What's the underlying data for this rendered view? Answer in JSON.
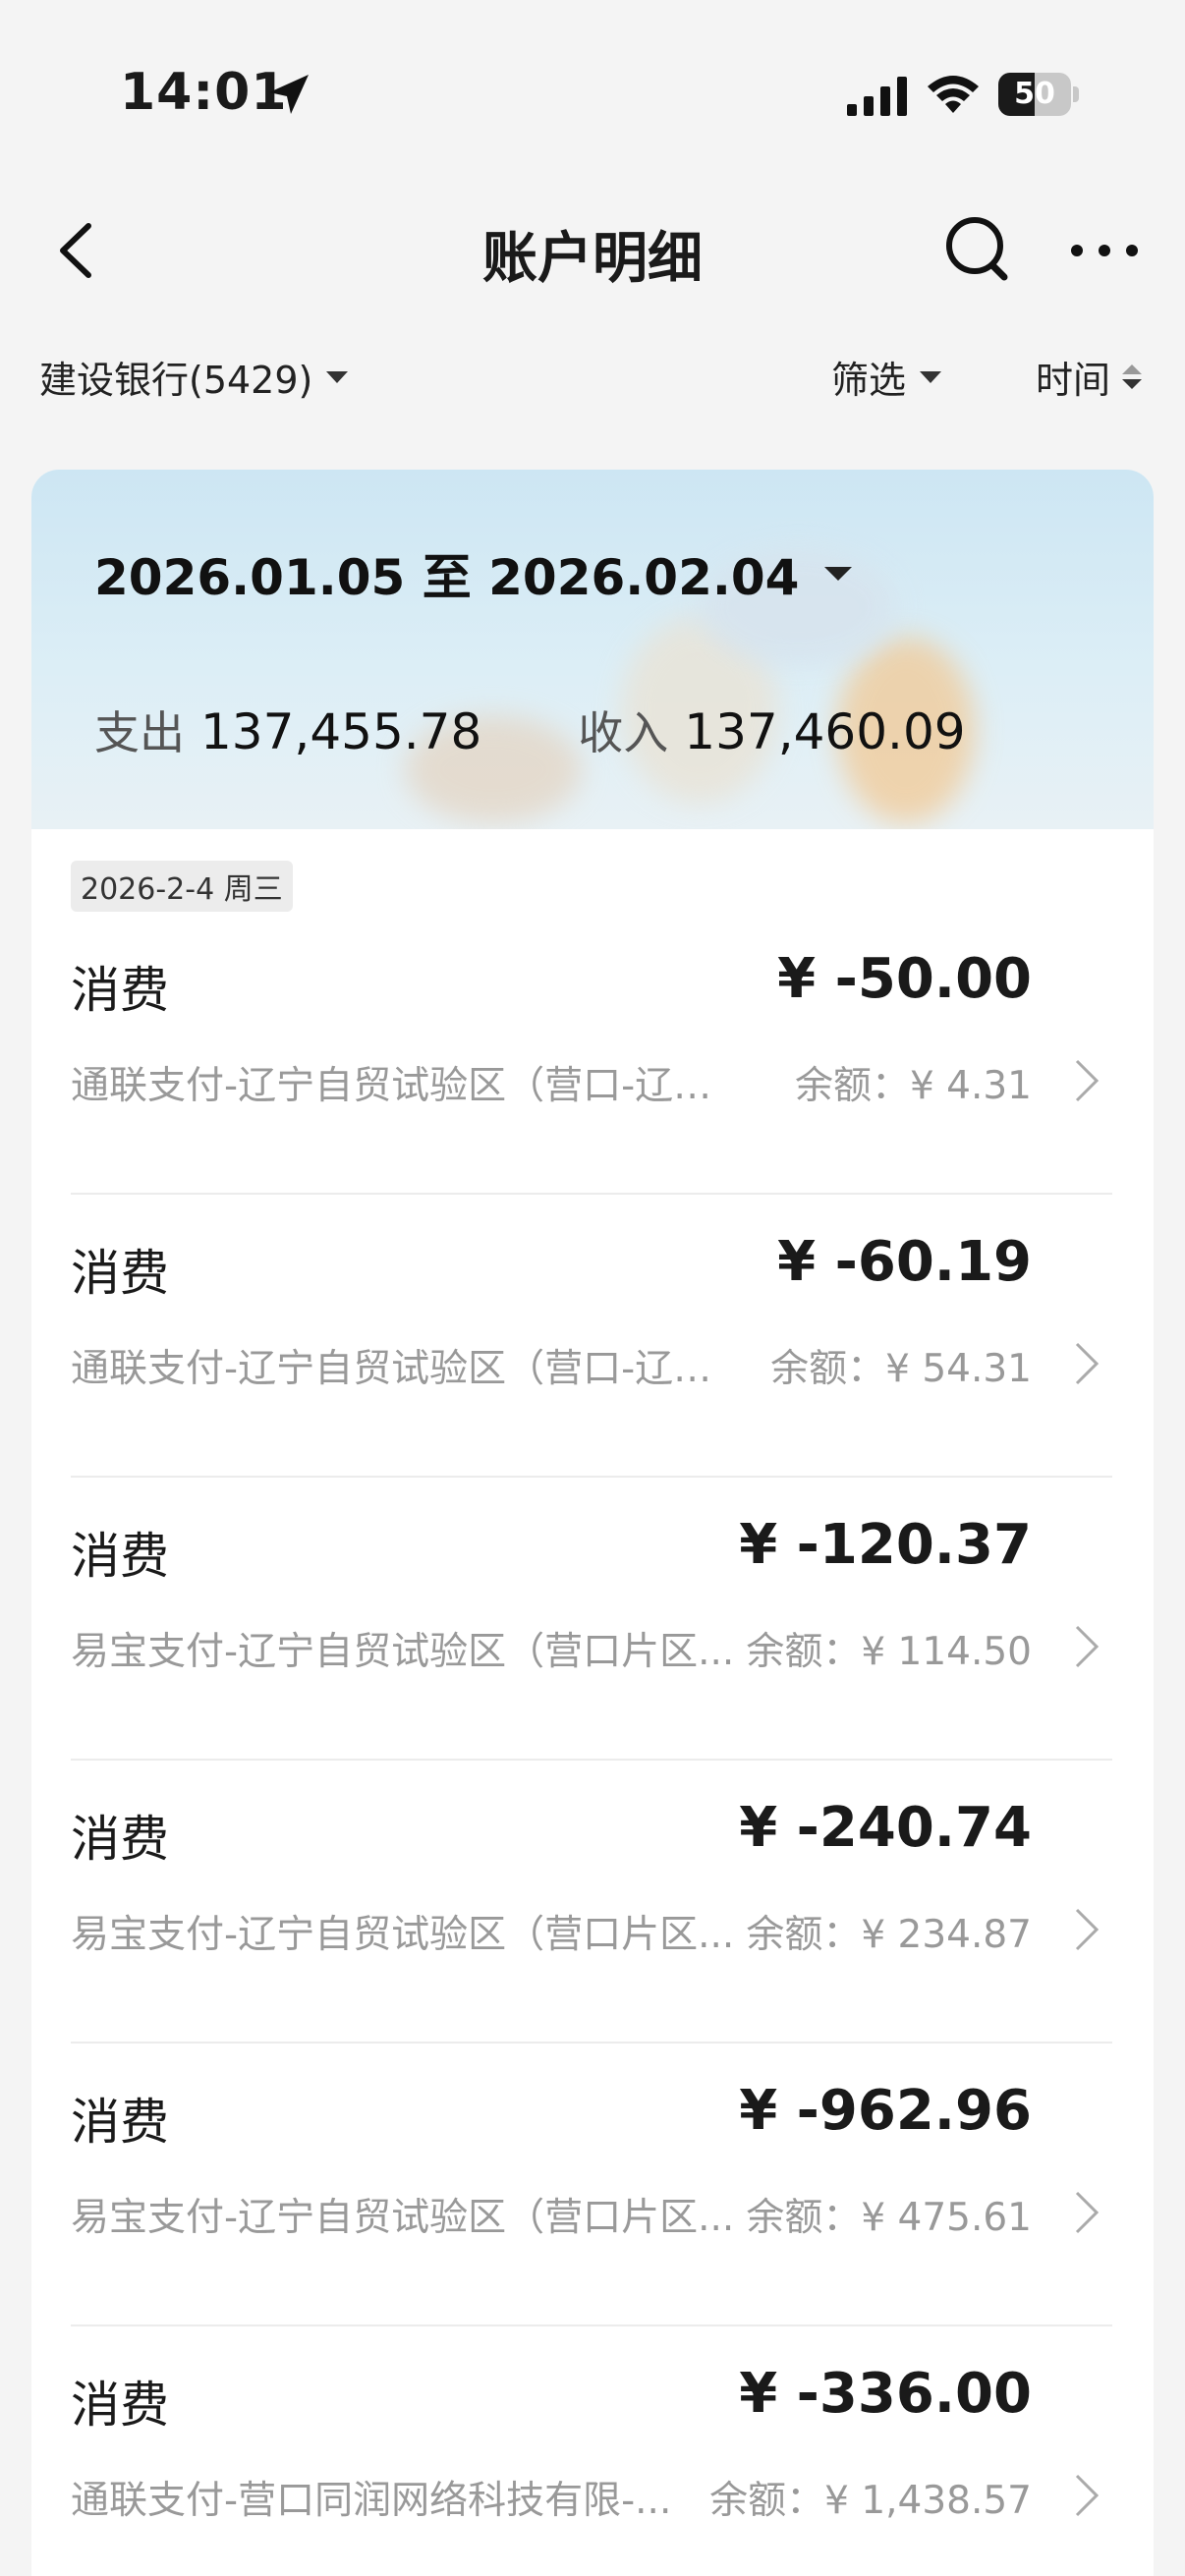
{
  "status_bar": {
    "time": "14:01",
    "battery_level": "50",
    "battery_fraction": 0.5,
    "icons": [
      "location-arrow-icon",
      "signal-icon",
      "wifi-icon",
      "battery-icon"
    ]
  },
  "nav": {
    "title": "账户明细",
    "icons": [
      "back-icon",
      "search-icon",
      "more-icon"
    ]
  },
  "filters": {
    "account": "建设银行(5429)",
    "filter_label": "筛选",
    "sort_label": "时间"
  },
  "summary": {
    "date_range": "2026.01.05 至 2026.02.04",
    "expense_label": "支出",
    "expense_value": "137,455.78",
    "income_label": "收入",
    "income_value": "137,460.09"
  },
  "transactions": {
    "day_label": "2026-2-4 周三",
    "items": [
      {
        "type": "消费",
        "amount": "¥ -50.00",
        "merchant": "通联支付-辽宁自贸试验区（营口-辽宁...",
        "balance": "余额：¥ 4.31"
      },
      {
        "type": "消费",
        "amount": "¥ -60.19",
        "merchant": "通联支付-辽宁自贸试验区（营口-辽宁...",
        "balance": "余额：¥ 54.31"
      },
      {
        "type": "消费",
        "amount": "¥ -120.37",
        "merchant": "易宝支付-辽宁自贸试验区（营口片区...",
        "balance": "余额：¥ 114.50"
      },
      {
        "type": "消费",
        "amount": "¥ -240.74",
        "merchant": "易宝支付-辽宁自贸试验区（营口片区...",
        "balance": "余额：¥ 234.87"
      },
      {
        "type": "消费",
        "amount": "¥ -962.96",
        "merchant": "易宝支付-辽宁自贸试验区（营口片区...",
        "balance": "余额：¥ 475.61"
      },
      {
        "type": "消费",
        "amount": "¥ -336.00",
        "merchant": "通联支付-营口同润网络科技有限-...",
        "balance": "余额：¥ 1,438.57"
      }
    ]
  },
  "colors": {
    "background": "#f4f4f4",
    "card": "#ffffff",
    "banner_top": "#cde6f3",
    "secondary_text": "#999999",
    "divider": "#ececec"
  }
}
